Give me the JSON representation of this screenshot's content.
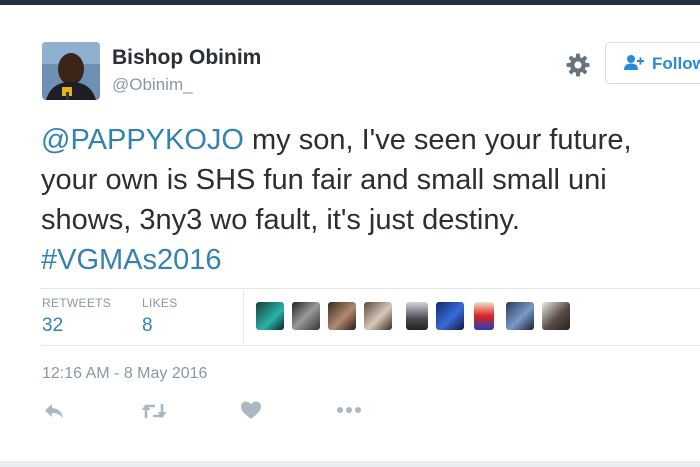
{
  "author": {
    "display_name": "Bishop Obinim",
    "handle": "@Obinim_"
  },
  "header": {
    "follow_label": "Follow"
  },
  "tweet": {
    "mention": "@PAPPYKOJO",
    "line1_rest": " my son, I've seen your future,",
    "line2": "your own is SHS fun fair and small small uni",
    "line3": "shows, 3ny3 wo fault, it's just destiny.",
    "hashtag": "#VGMAs2016"
  },
  "stats": {
    "retweets_label": "RETWEETS",
    "retweets_count": "32",
    "likes_label": "LIKES",
    "likes_count": "8"
  },
  "liker_count_shown": 9,
  "timestamp": "12:16 AM - 8 May 2016",
  "icons": {
    "settings": "gear-icon",
    "follow": "add-user-icon",
    "reply": "reply-icon",
    "retweet": "retweet-icon",
    "like": "heart-icon",
    "more": "more-icon"
  },
  "colors": {
    "link": "#3382b4",
    "follow_text": "#2a8ad8",
    "muted": "#8899a6",
    "text": "#292f33"
  }
}
